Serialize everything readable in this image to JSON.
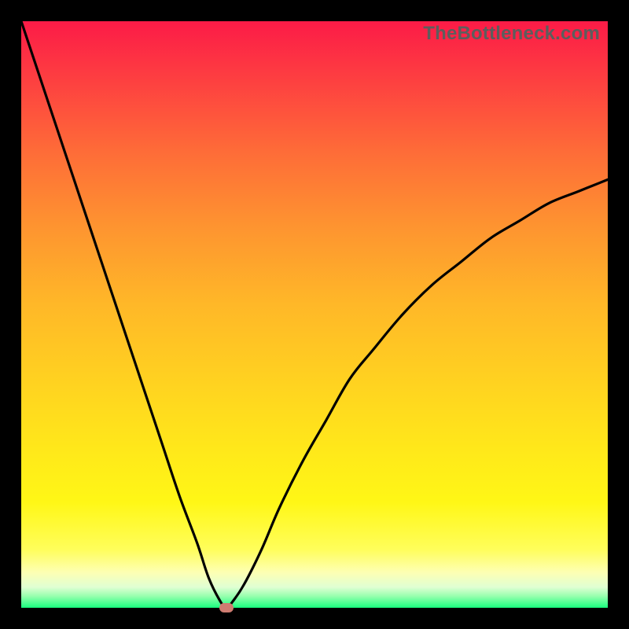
{
  "watermark": "TheBottleneck.com",
  "colors": {
    "frame": "#000000",
    "curve": "#000000",
    "marker": "#cf7c71",
    "gradient_top": "#fc1b47",
    "gradient_bottom": "#19ff7e"
  },
  "chart_data": {
    "type": "line",
    "title": "",
    "xlabel": "",
    "ylabel": "",
    "xlim": [
      0,
      100
    ],
    "ylim": [
      0,
      100
    ],
    "annotations": [
      {
        "text": "TheBottleneck.com",
        "pos": "top-right"
      }
    ],
    "series": [
      {
        "name": "bottleneck-curve",
        "x": [
          0,
          3,
          6,
          9,
          12,
          15,
          18,
          21,
          24,
          27,
          30,
          32,
          34,
          35,
          36,
          38,
          41,
          44,
          48,
          52,
          56,
          60,
          65,
          70,
          75,
          80,
          85,
          90,
          95,
          100
        ],
        "y": [
          100,
          91,
          82,
          73,
          64,
          55,
          46,
          37,
          28,
          19,
          11,
          5,
          1,
          0,
          1,
          4,
          10,
          17,
          25,
          32,
          39,
          44,
          50,
          55,
          59,
          63,
          66,
          69,
          71,
          73
        ]
      }
    ],
    "marker": {
      "x": 35,
      "y": 0
    }
  }
}
